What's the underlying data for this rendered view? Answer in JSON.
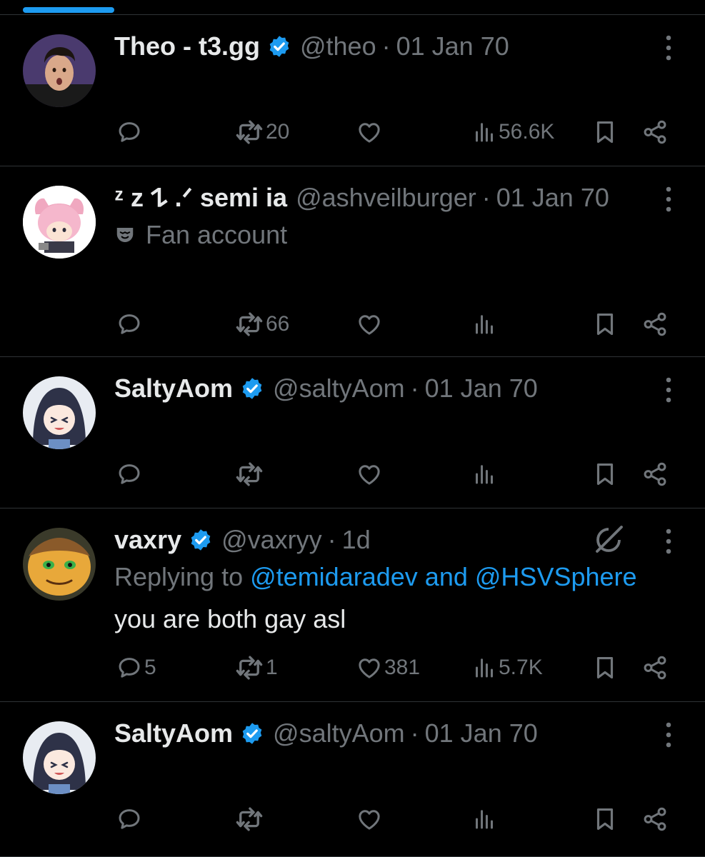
{
  "colors": {
    "background": "#000000",
    "text": "#e7e9ea",
    "muted": "#71767b",
    "accent": "#1d9bf0",
    "divider": "#2f3336"
  },
  "tweets": [
    {
      "name": "Theo - t3.gg",
      "verified": true,
      "handle": "@theo",
      "separator": "·",
      "date": "01 Jan 70",
      "metrics": {
        "replies": "",
        "reposts": "20",
        "likes": "",
        "views": "56.6K"
      }
    },
    {
      "name": "ᶻ z 𐰁 .ᐟ semi ia",
      "verified": false,
      "handle": "@ashveilburger",
      "separator": "·",
      "date": "01 Jan 70",
      "badge_icon": "theater-mask-icon",
      "badge_label": "Fan account",
      "metrics": {
        "replies": "",
        "reposts": "66",
        "likes": "",
        "views": ""
      }
    },
    {
      "name": "SaltyAom",
      "verified": true,
      "handle": "@saltyAom",
      "separator": "·",
      "date": "01 Jan 70",
      "metrics": {
        "replies": "",
        "reposts": "",
        "likes": "",
        "views": ""
      }
    },
    {
      "name": "vaxry",
      "verified": true,
      "handle": "@vaxryy",
      "separator": "·",
      "date": "1d",
      "reply_prefix": "Replying to",
      "reply_to_1": "@temidaradev",
      "reply_and": "and",
      "reply_to_2": "@HSVSphere",
      "text": "you are both gay asl",
      "metrics": {
        "replies": "5",
        "reposts": "1",
        "likes": "381",
        "views": "5.7K"
      }
    },
    {
      "name": "SaltyAom",
      "verified": true,
      "handle": "@saltyAom",
      "separator": "·",
      "date": "01 Jan 70",
      "metrics": {
        "replies": "",
        "reposts": "",
        "likes": "",
        "views": ""
      }
    }
  ]
}
